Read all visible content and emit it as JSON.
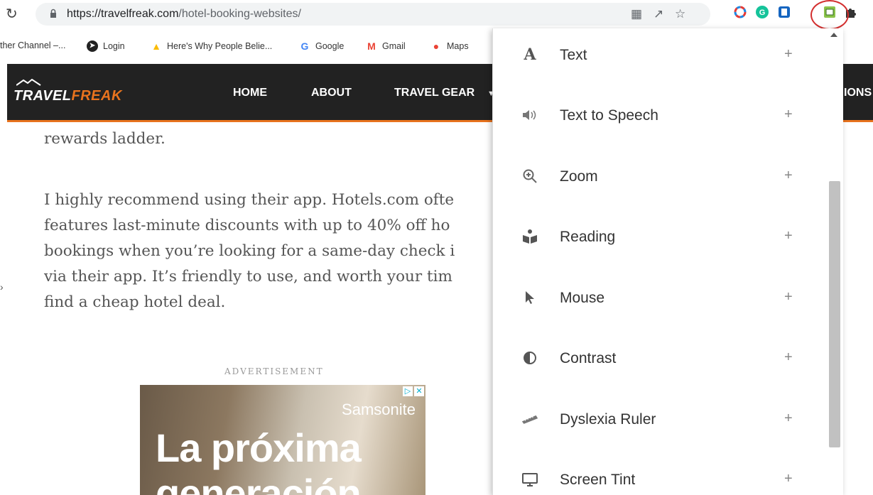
{
  "browser": {
    "url_host": "https://travelfreak.com",
    "url_path": "/hotel-booking-websites/"
  },
  "bookmarks": [
    {
      "label": "ther Channel –..."
    },
    {
      "label": "Login"
    },
    {
      "label": "Here's Why People Belie..."
    },
    {
      "label": "Google"
    },
    {
      "label": "Gmail"
    },
    {
      "label": "Maps"
    }
  ],
  "site": {
    "logo_part1": "TRAVEL",
    "logo_part2": "FREAK",
    "nav": [
      "HOME",
      "ABOUT",
      "TRAVEL GEAR"
    ],
    "nav_cut": "IONS"
  },
  "article": {
    "line0": "rewards ladder.",
    "lines": [
      "I highly recommend using their app. Hotels.com ofte",
      "features last-minute discounts with up to 40% off ho",
      "bookings when you’re looking for a same-day check i",
      "via their app. It’s friendly to use, and worth your tim",
      "find a cheap hotel deal."
    ],
    "ad_label": "ADVERTISEMENT",
    "ad_brand": "Samsonite",
    "ad_line1": "La próxima",
    "ad_line2": "generación"
  },
  "panel": {
    "items": [
      {
        "label": "Text",
        "icon": "text-icon"
      },
      {
        "label": "Text to Speech",
        "icon": "speaker-icon"
      },
      {
        "label": "Zoom",
        "icon": "zoom-icon"
      },
      {
        "label": "Reading",
        "icon": "reading-icon"
      },
      {
        "label": "Mouse",
        "icon": "cursor-icon"
      },
      {
        "label": "Contrast",
        "icon": "contrast-icon"
      },
      {
        "label": "Dyslexia Ruler",
        "icon": "ruler-icon"
      },
      {
        "label": "Screen Tint",
        "icon": "monitor-icon"
      }
    ],
    "plus": "+"
  },
  "colors": {
    "accent": "#e8731e",
    "header_bg": "#222222",
    "highlight_circle": "#d32f2f"
  }
}
